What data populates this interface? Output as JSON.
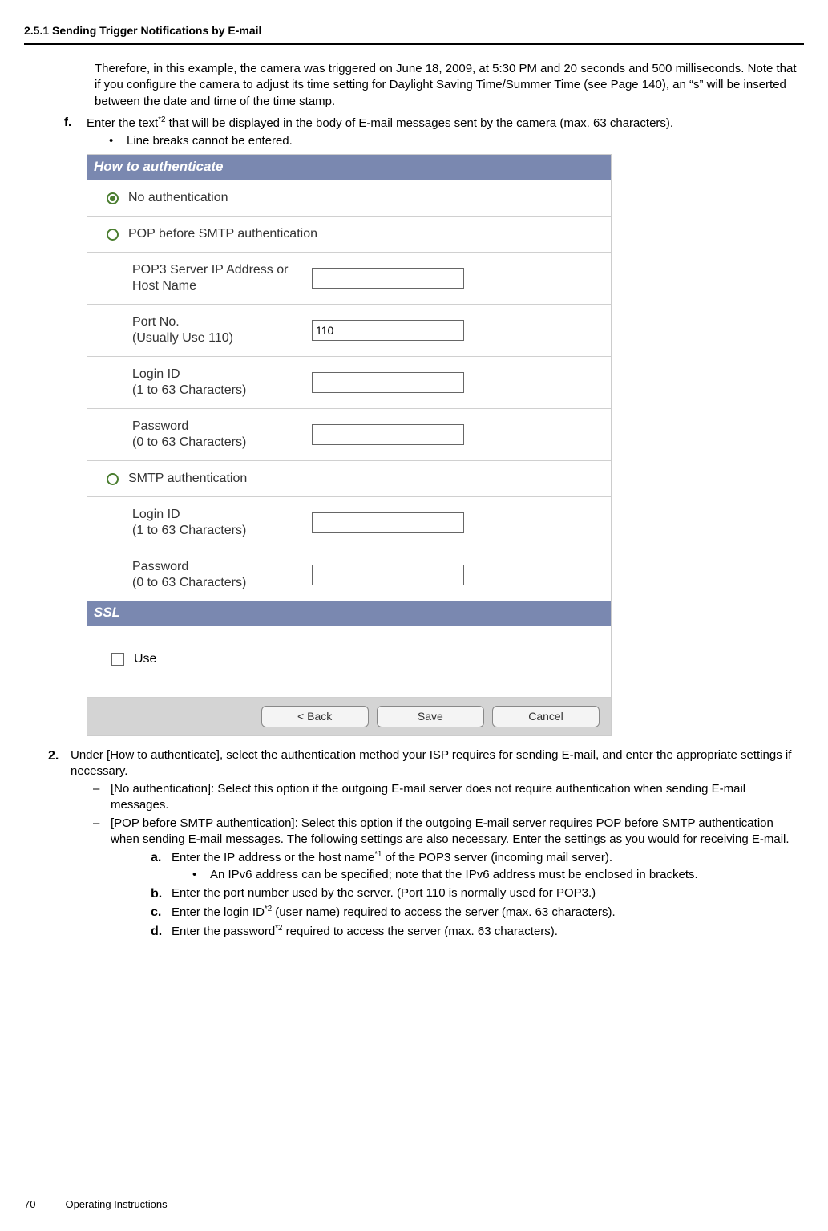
{
  "header": {
    "section_title": "2.5.1 Sending Trigger Notifications by E-mail"
  },
  "intro": {
    "para1": "Therefore, in this example, the camera was triggered on June 18, 2009, at 5:30 PM and 20 seconds and 500 milliseconds. Note that if you configure the camera to adjust its time setting for Daylight Saving Time/Summer Time (see Page 140), an “s” will be inserted between the date and time of the time stamp."
  },
  "item_f": {
    "marker": "f.",
    "text_before_sup": "Enter the text",
    "sup": "*2",
    "text_after_sup": " that will be displayed in the body of E-mail messages sent by the camera (max. 63 characters).",
    "bullet": "Line breaks cannot be entered."
  },
  "ui": {
    "header_auth": "How to authenticate",
    "no_auth": "No authentication",
    "pop_before_smtp": "POP before SMTP authentication",
    "pop3_label": "POP3 Server IP Address or Host Name",
    "pop3_value": "",
    "port_label_l1": "Port No.",
    "port_label_l2": "(Usually Use 110)",
    "port_value": "110",
    "login_label_l1": "Login ID",
    "login_label_l2": "(1 to 63 Characters)",
    "login_value": "",
    "pass_label_l1": "Password",
    "pass_label_l2": "(0 to 63 Characters)",
    "pass_value": "",
    "smtp_auth": "SMTP authentication",
    "smtp_login_l1": "Login ID",
    "smtp_login_l2": "(1 to 63 Characters)",
    "smtp_login_value": "",
    "smtp_pass_l1": "Password",
    "smtp_pass_l2": "(0 to 63 Characters)",
    "smtp_pass_value": "",
    "ssl_header": "SSL",
    "ssl_use": "Use",
    "btn_back": "<  Back",
    "btn_save": "Save",
    "btn_cancel": "Cancel"
  },
  "item_2": {
    "marker": "2.",
    "text": "Under [How to authenticate], select the authentication method your ISP requires for sending E-mail, and enter the appropriate settings if necessary.",
    "dash1": "[No authentication]: Select this option if the outgoing E-mail server does not require authentication when sending E-mail messages.",
    "dash2": "[POP before SMTP authentication]: Select this option if the outgoing E-mail server requires POP before SMTP authentication when sending E-mail messages. The following settings are also necessary. Enter the settings as you would for receiving E-mail.",
    "a": {
      "marker": "a.",
      "before": "Enter the IP address or the host name",
      "sup": "*1",
      "after": " of the POP3 server (incoming mail server).",
      "sub": "An IPv6 address can be specified; note that the IPv6 address must be enclosed in brackets."
    },
    "b": {
      "marker": "b.",
      "text": "Enter the port number used by the server. (Port 110 is normally used for POP3.)"
    },
    "c": {
      "marker": "c.",
      "before": "Enter the login ID",
      "sup": "*2",
      "after": " (user name) required to access the server (max. 63 characters)."
    },
    "d": {
      "marker": "d.",
      "before": "Enter the password",
      "sup": "*2",
      "after": " required to access the server (max. 63 characters)."
    }
  },
  "footer": {
    "page": "70",
    "doc": "Operating Instructions"
  }
}
